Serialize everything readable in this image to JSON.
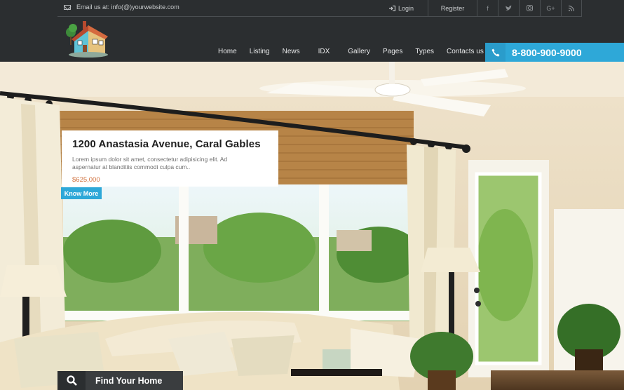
{
  "topbar": {
    "email_text": "Email us at: info(@)yourwebsite.com",
    "login_label": "Login",
    "register_label": "Register",
    "social_icons": [
      "f",
      "t",
      "◎",
      "G+",
      "≡"
    ]
  },
  "nav": {
    "items": [
      "Home",
      "Listing",
      "News",
      "IDX",
      "Gallery",
      "Pages",
      "Types",
      "Contacts us"
    ]
  },
  "contact": {
    "phone": "8-800-900-9000"
  },
  "hero": {
    "title": "1200 Anastasia Avenue, Caral Gables",
    "description": "Lorem ipsum dolor sit amet, consectetur adipisicing elit. Ad asperna­tur at blanditiis commodi culpa cum..",
    "price": "$625,000",
    "cta_label": "Know More"
  },
  "search": {
    "label": "Find Your Home"
  },
  "colors": {
    "accent": "#2ea8d8",
    "dark": "#2b2e30",
    "price": "#d0713e"
  }
}
